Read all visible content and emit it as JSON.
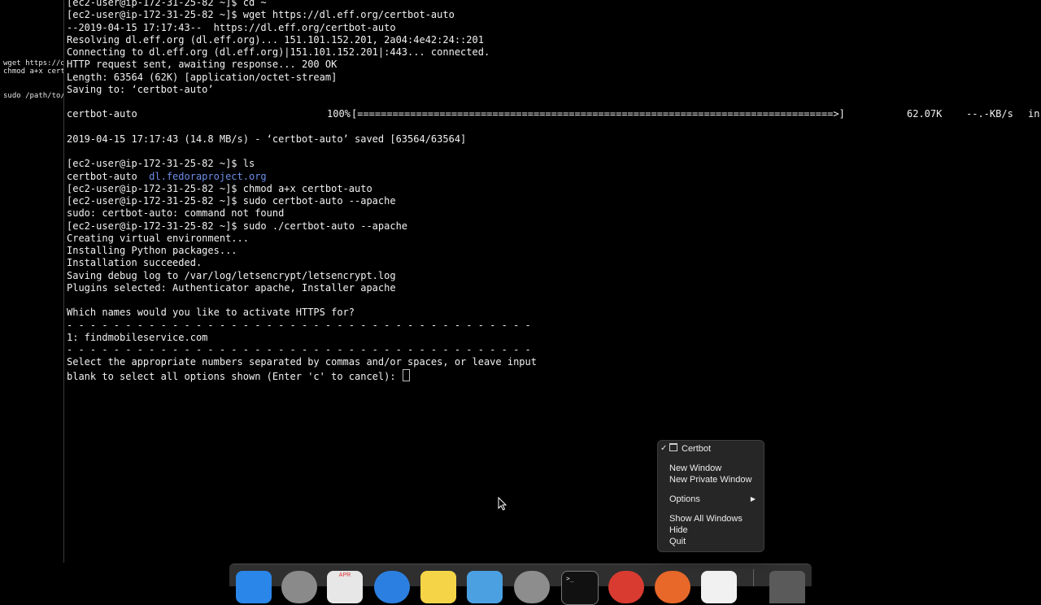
{
  "left_pane": {
    "lines": [
      "wget https://d",
      "chmod a+x cert",
      "",
      "",
      "sudo /path/to/"
    ]
  },
  "terminal": {
    "lines": [
      "[ec2-user@ip-172-31-25-82 ~]$ cd ~",
      "[ec2-user@ip-172-31-25-82 ~]$ wget https://dl.eff.org/certbot-auto",
      "--2019-04-15 17:17:43--  https://dl.eff.org/certbot-auto",
      "Resolving dl.eff.org (dl.eff.org)... 151.101.152.201, 2a04:4e42:24::201",
      "Connecting to dl.eff.org (dl.eff.org)|151.101.152.201|:443... connected.",
      "HTTP request sent, awaiting response... 200 OK",
      "Length: 63564 (62K) [application/octet-stream]",
      "Saving to: ‘certbot-auto’",
      "",
      "PROGRESS",
      "",
      "2019-04-15 17:17:43 (14.8 MB/s) - ‘certbot-auto’ saved [63564/63564]",
      "",
      "[ec2-user@ip-172-31-25-82 ~]$ ls",
      "LSOUT",
      "[ec2-user@ip-172-31-25-82 ~]$ chmod a+x certbot-auto",
      "[ec2-user@ip-172-31-25-82 ~]$ sudo certbot-auto --apache",
      "sudo: certbot-auto: command not found",
      "[ec2-user@ip-172-31-25-82 ~]$ sudo ./certbot-auto --apache",
      "Creating virtual environment...",
      "Installing Python packages...",
      "Installation succeeded.",
      "Saving debug log to /var/log/letsencrypt/letsencrypt.log",
      "Plugins selected: Authenticator apache, Installer apache",
      "",
      "Which names would you like to activate HTTPS for?",
      "- - - - - - - - - - - - - - - - - - - - - - - - - - - - - - - - - - - - - - - -",
      "1: findmobileservice.com",
      "- - - - - - - - - - - - - - - - - - - - - - - - - - - - - - - - - - - - - - - -",
      "Select the appropriate numbers separated by commas and/or spaces, or leave input",
      "PROMPT"
    ],
    "progress": {
      "file": "certbot-auto",
      "percent": "100%",
      "bar": "[=================================================================================>]",
      "size": "62.07K",
      "rate": "--.-KB/s",
      "eta": "in"
    },
    "ls_output": {
      "file": "certbot-auto",
      "dir": "dl.fedoraproject.org"
    },
    "prompt_line": "blank to select all options shown (Enter 'c' to cancel): "
  },
  "context_menu": {
    "app_item": "Certbot",
    "items": [
      "New Window",
      "New Private Window",
      "Options",
      "Show All Windows",
      "Hide",
      "Quit"
    ]
  },
  "dock": {
    "calendar_month": "APR",
    "apps": [
      "finder-icon",
      "launchpad-icon",
      "calendar-icon",
      "safari-icon",
      "notes-icon",
      "mail-icon",
      "system-preferences-icon",
      "terminal-icon",
      "chrome-icon",
      "firefox-icon",
      "textedit-icon",
      "trash-icon"
    ],
    "colors": {
      "finder": "#2a86e8",
      "launchpad": "#8a8a8a",
      "calendar": "#e7e7e7",
      "safari": "#2b7fe0",
      "notes": "#f5d547",
      "mail": "#4aa0e0",
      "sysprefs": "#8d8d8d",
      "terminal": "#111111",
      "chrome": "#d93b30",
      "firefox": "#e8682a",
      "textedit": "#f1f1f1",
      "trash": "#5a5a5a"
    }
  }
}
